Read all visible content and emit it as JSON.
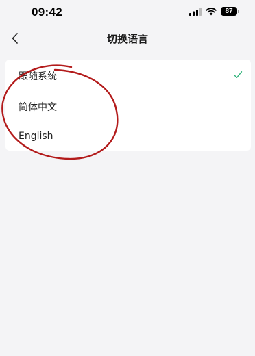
{
  "status_bar": {
    "time": "09:42",
    "battery": "87",
    "icons": [
      "signal-icon",
      "wifi-icon",
      "battery-icon"
    ]
  },
  "nav": {
    "back_icon": "chevron-left-icon",
    "title": "切换语言"
  },
  "languages": {
    "items": [
      {
        "label": "跟随系统",
        "selected": true
      },
      {
        "label": "简体中文",
        "selected": false
      },
      {
        "label": "English",
        "selected": false
      }
    ]
  },
  "colors": {
    "accent_check": "#2fb37a",
    "annotation": "#b31b1b",
    "background": "#f4f4f6"
  }
}
